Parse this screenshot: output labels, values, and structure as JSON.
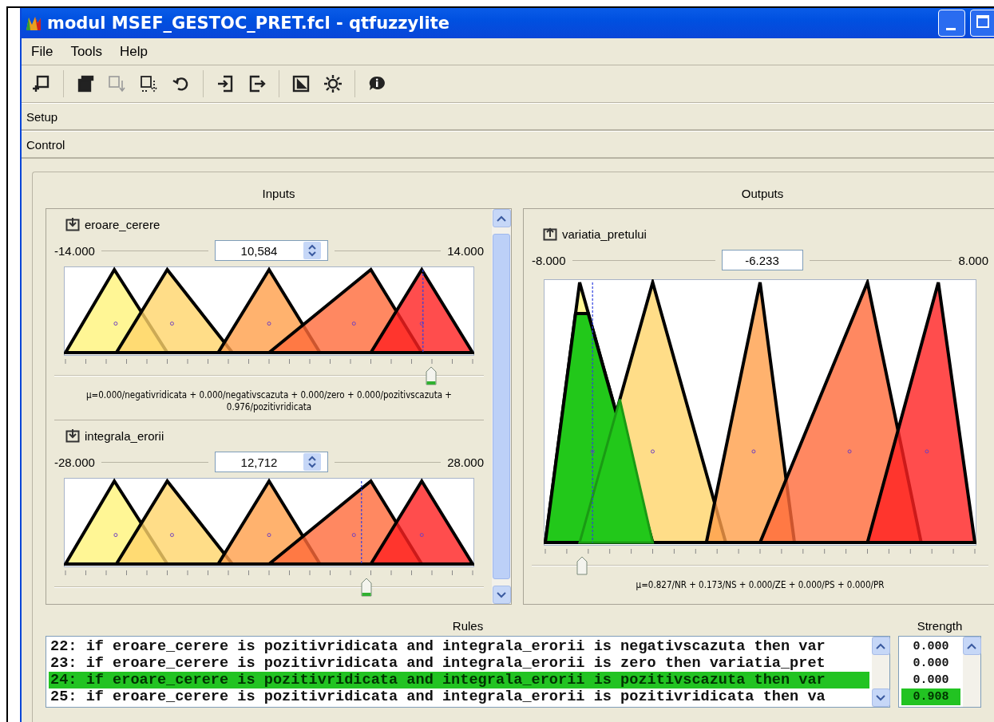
{
  "window": {
    "title": "modul MSEF_GESTOC_PRET.fcl - qtfuzzylite"
  },
  "menu": [
    "File",
    "Tools",
    "Help"
  ],
  "toolbar": [
    {
      "kind": "new",
      "disabled": false
    },
    {
      "kind": "copy",
      "disabled": false
    },
    {
      "kind": "import",
      "disabled": true
    },
    {
      "kind": "import-all",
      "disabled": false
    },
    {
      "kind": "undo",
      "disabled": false
    },
    {
      "kind": "enter",
      "disabled": false
    },
    {
      "kind": "exit",
      "disabled": false
    },
    {
      "kind": "frame",
      "disabled": false
    },
    {
      "kind": "settings",
      "disabled": false
    },
    {
      "kind": "info",
      "disabled": false
    }
  ],
  "sections": [
    "Setup",
    "Control"
  ],
  "inputs": {
    "title": "Inputs",
    "variables": [
      {
        "name": "eroare_cerere",
        "min": "-14.000",
        "max": "14.000",
        "value": "10,584",
        "level": 0.878,
        "membership": "μ=0.000/negativridicata + 0.000/negativscazuta + 0.000/zero + 0.000/pozitivscazuta + 0.976/pozitivridicata"
      },
      {
        "name": "integrala_erorii",
        "min": "-28.000",
        "max": "28.000",
        "value": "12,712",
        "level": 0.727
      }
    ]
  },
  "outputs": {
    "title": "Outputs",
    "variables": [
      {
        "name": "variatia_pretului",
        "min": "-8.000",
        "max": "8.000",
        "value": "-6.233",
        "level": 0.11,
        "membership": "μ=0.827/NR + 0.173/NS + 0.000/ZE + 0.000/PS + 0.000/PR"
      }
    ]
  },
  "rules": {
    "title": "Rules",
    "items": [
      {
        "text": "22: if eroare_cerere is pozitivridicata and integrala_erorii is negativscazuta then var",
        "selected": false
      },
      {
        "text": "23: if eroare_cerere is pozitivridicata and integrala_erorii is zero then variatia_pret",
        "selected": false
      },
      {
        "text": "24: if eroare_cerere is pozitivridicata and integrala_erorii is pozitivscazuta then var",
        "selected": true
      },
      {
        "text": "25: if eroare_cerere is pozitivridicata and integrala_erorii is pozitivridicata then va",
        "selected": false
      }
    ]
  },
  "strength": {
    "title": "Strength",
    "items": [
      {
        "text": "0.000",
        "selected": false
      },
      {
        "text": "0.000",
        "selected": false
      },
      {
        "text": "0.000",
        "selected": false
      },
      {
        "text": "0.908",
        "selected": true
      }
    ]
  }
}
